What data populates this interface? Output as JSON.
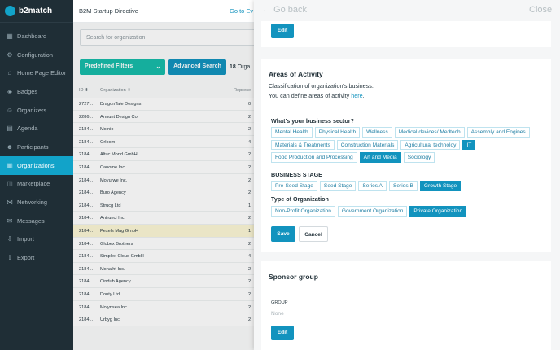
{
  "app": {
    "name": "b2match"
  },
  "sidebar": {
    "items": [
      {
        "label": "Dashboard",
        "icon": "dashboard-icon"
      },
      {
        "label": "Configuration",
        "icon": "gear-icon"
      },
      {
        "label": "Home Page Editor",
        "icon": "home-icon"
      },
      {
        "label": "Badges",
        "icon": "badge-icon"
      },
      {
        "label": "Organizers",
        "icon": "organizers-icon"
      },
      {
        "label": "Agenda",
        "icon": "calendar-icon"
      },
      {
        "label": "Participants",
        "icon": "participants-icon"
      },
      {
        "label": "Organizations",
        "icon": "building-icon"
      },
      {
        "label": "Marketplace",
        "icon": "marketplace-icon"
      },
      {
        "label": "Networking",
        "icon": "networking-icon"
      },
      {
        "label": "Messages",
        "icon": "messages-icon"
      },
      {
        "label": "Import",
        "icon": "import-icon"
      },
      {
        "label": "Export",
        "icon": "export-icon"
      }
    ],
    "active": "Organizations"
  },
  "topbar": {
    "event_title": "B2M Startup Directive",
    "go_to_event": "Go to Ev"
  },
  "list": {
    "search_placeholder": "Search for organization",
    "predefined_filters": "Predefined Filters",
    "advanced_search": "Advanced Search",
    "count_number": "18",
    "count_label": "Orga",
    "headers": {
      "id": "ID",
      "organization": "Organization",
      "representative": "Represe"
    },
    "rows": [
      {
        "id": "2727...",
        "name": "DragonTale Designs",
        "rep": "0"
      },
      {
        "id": "2286...",
        "name": "Armunt Design Co.",
        "rep": "2"
      },
      {
        "id": "2184...",
        "name": "Molnio",
        "rep": "2"
      },
      {
        "id": "2184...",
        "name": "Orloom",
        "rep": "4"
      },
      {
        "id": "2184...",
        "name": "Altuc Mond GmbH",
        "rep": "2"
      },
      {
        "id": "2184...",
        "name": "Canome Inc.",
        "rep": "2"
      },
      {
        "id": "2184...",
        "name": "Moyurwe Inc.",
        "rep": "2"
      },
      {
        "id": "2184...",
        "name": "Buro Agency",
        "rep": "2"
      },
      {
        "id": "2184...",
        "name": "Strucg Ltd",
        "rep": "1"
      },
      {
        "id": "2184...",
        "name": "Antrunci Inc.",
        "rep": "2"
      },
      {
        "id": "2184...",
        "name": "Pexels Mag GmbH",
        "rep": "1"
      },
      {
        "id": "2184...",
        "name": "Globex Brothers",
        "rep": "2"
      },
      {
        "id": "2184...",
        "name": "Simplex Cloud GmbH",
        "rep": "4"
      },
      {
        "id": "2184...",
        "name": "Monaiht Inc.",
        "rep": "2"
      },
      {
        "id": "2184...",
        "name": "Cindub Agency",
        "rep": "2"
      },
      {
        "id": "2184...",
        "name": "Douty Ltd",
        "rep": "2"
      },
      {
        "id": "2184...",
        "name": "Molynsea Inc.",
        "rep": "2"
      },
      {
        "id": "2184...",
        "name": "Urbyg Inc.",
        "rep": "2"
      }
    ]
  },
  "panel": {
    "back": "Go back",
    "close": "Close",
    "edit": "Edit",
    "areas": {
      "title": "Areas of Activity",
      "desc1": "Classification of organization's business.",
      "desc2_prefix": "You can define areas of activity ",
      "desc2_link": "here",
      "desc2_suffix": ".",
      "sector_label": "What's your business sector?",
      "sectors": [
        {
          "label": "Mental Health",
          "selected": false
        },
        {
          "label": "Physical Health",
          "selected": false
        },
        {
          "label": "Wellness",
          "selected": false
        },
        {
          "label": "Medical devices/ Medtech",
          "selected": false
        },
        {
          "label": "Assembly and Engines",
          "selected": false
        },
        {
          "label": "Materials & Treatments",
          "selected": false
        },
        {
          "label": "Construction Materials",
          "selected": false
        },
        {
          "label": "Agricultural technoloy",
          "selected": false
        },
        {
          "label": "IT",
          "selected": true
        },
        {
          "label": "Food Production and Processing",
          "selected": false
        },
        {
          "label": "Art and Media",
          "selected": true
        },
        {
          "label": "Sociology",
          "selected": false
        }
      ],
      "stage_label": "BUSINESS STAGE",
      "stages": [
        {
          "label": "Pre-Seed Stage",
          "selected": false
        },
        {
          "label": "Seed Stage",
          "selected": false
        },
        {
          "label": "Series A",
          "selected": false
        },
        {
          "label": "Series B",
          "selected": false
        },
        {
          "label": "Growth Stage",
          "selected": true
        }
      ],
      "type_label": "Type of Organization",
      "types": [
        {
          "label": "Non-Profit Organization",
          "selected": false
        },
        {
          "label": "Government Organization",
          "selected": false
        },
        {
          "label": "Private Organization",
          "selected": true
        }
      ],
      "save": "Save",
      "cancel": "Cancel"
    },
    "sponsor": {
      "title": "Sponsor group",
      "group_label": "GROUP",
      "group_value": "None",
      "edit": "Edit"
    }
  },
  "colors": {
    "accent": "#1293be",
    "sidebar": "#1f2e36",
    "teal": "#17bca9",
    "highlight_row": "#fcf7d5"
  }
}
